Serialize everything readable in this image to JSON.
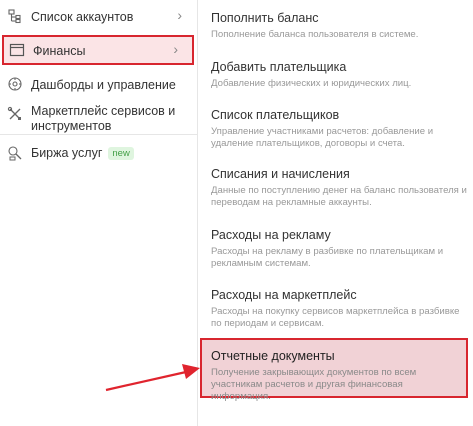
{
  "sidebar": {
    "items": [
      {
        "label": "Список аккаунтов",
        "icon": "accounts-icon",
        "chevron": true
      },
      {
        "label": "Финансы",
        "icon": "window-icon",
        "chevron": true,
        "active": true
      },
      {
        "label": "Дашборды и управление",
        "icon": "dashboard-icon"
      },
      {
        "label": "Маркетплейс сервисов и инструментов",
        "icon": "tools-icon"
      },
      {
        "label": "Биржа услуг",
        "icon": "exchange-icon",
        "badge": "new"
      }
    ]
  },
  "menu": {
    "items": [
      {
        "title": "Пополнить баланс",
        "desc": "Пополнение баланса пользователя в системе."
      },
      {
        "title": "Добавить плательщика",
        "desc": "Добавление физических и юридических лиц."
      },
      {
        "title": "Список плательщиков",
        "desc": "Управление участниками расчетов: добавление и удаление плательщиков, договоры и счета."
      },
      {
        "title": "Списания и начисления",
        "desc": "Данные по поступлению денег на баланс пользователя и переводам на рекламные аккаунты."
      },
      {
        "title": "Расходы на рекламу",
        "desc": "Расходы на рекламу в разбивке по плательщикам и рекламным системам."
      },
      {
        "title": "Расходы на маркетплейс",
        "desc": "Расходы на покупку сервисов маркетплейса в разбивке по периодам и сервисам."
      },
      {
        "title": "Отчетные документы",
        "desc": "Получение закрывающих документов по всем участникам расчетов и другая финансовая информация.",
        "highlighted": true
      }
    ]
  },
  "colors": {
    "accent": "#d8262f",
    "highlight_bg": "#f1d2d6",
    "badge_bg": "#dff5df",
    "badge_fg": "#43a047"
  }
}
